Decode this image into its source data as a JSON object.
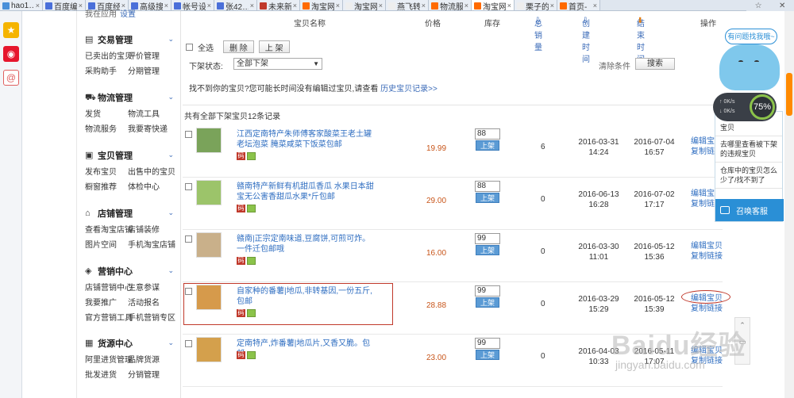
{
  "browser_tabs": [
    {
      "label": "hao1…",
      "color": "#4a90d9"
    },
    {
      "label": "百度编",
      "color": "#4a6fd9"
    },
    {
      "label": "百度经",
      "color": "#4a6fd9"
    },
    {
      "label": "高级搜",
      "color": "#4a6fd9"
    },
    {
      "label": "帐号设",
      "color": "#4a6fd9"
    },
    {
      "label": "张42…",
      "color": "#4a6fd9"
    },
    {
      "label": "未来新",
      "color": "#c0392b"
    },
    {
      "label": "淘宝网",
      "color": "#ff6a00"
    },
    {
      "label": "淘宝网",
      "color": "#eeeeee"
    },
    {
      "label": "燕飞转",
      "color": "#eeeeee"
    },
    {
      "label": "物流服",
      "color": "#ff6a00"
    },
    {
      "label": "淘宝网",
      "color": "#ff6a00"
    },
    {
      "label": "栗子的",
      "color": "#eeeeee"
    },
    {
      "label": "首页-",
      "color": "#ff6a00"
    }
  ],
  "left_nav": {
    "top_text": "我在应用",
    "top_sub": "设置",
    "groups": [
      {
        "icon": "document-icon",
        "title": "交易管理",
        "links": [
          "已卖出的宝贝",
          "评价管理",
          "采购助手",
          "分期管理"
        ]
      },
      {
        "icon": "truck-icon",
        "title": "物流管理",
        "links": [
          "发货",
          "物流工具",
          "物流服务",
          "我要寄快递"
        ]
      },
      {
        "icon": "bag-icon",
        "title": "宝贝管理",
        "links": [
          "发布宝贝",
          "出售中的宝贝",
          "橱窗推荐",
          "体检中心"
        ]
      },
      {
        "icon": "shop-icon",
        "title": "店铺管理",
        "links": [
          "查看淘宝店铺",
          "店铺装修",
          "图片空间",
          "手机淘宝店铺"
        ]
      },
      {
        "icon": "megaphone-icon",
        "title": "营销中心",
        "links": [
          "店铺营销中心",
          "生意参谋",
          "我要推广",
          "活动报名",
          "官方营销工具",
          "手机营销专区"
        ]
      },
      {
        "icon": "cube-icon",
        "title": "货源中心",
        "links": [
          "阿里进货管理",
          "品牌货源",
          "批发进货",
          "分销管理"
        ]
      }
    ]
  },
  "table_header": {
    "name": "宝贝名称",
    "price": "价格",
    "stock": "库存",
    "sales": "总销量",
    "created": "创建时间",
    "end": "结束时间",
    "ops": "操作"
  },
  "toolbar": {
    "select_all": "全选",
    "delete": "删 除",
    "list": "上 架"
  },
  "filter": {
    "label": "下架状态:",
    "value": "全部下架",
    "clear": "清除条件",
    "search": "搜索"
  },
  "hint": {
    "text": "找不到你的宝贝?您可能长时间没有编辑过宝贝,请查看",
    "link": "历史宝贝记录>>"
  },
  "count_text": "共有全部下架宝贝12条记录",
  "rows": [
    {
      "title": "江西定南特产朱师傅客家酸菜王老土罐老坛泡菜 腌菜咸菜下饭菜包邮",
      "price": "19.99",
      "stock": "88",
      "shelf": "上架",
      "sales": "6",
      "created": [
        "2016-03-31",
        "14:24"
      ],
      "end": [
        "2016-07-04",
        "16:57"
      ],
      "ops": [
        "编辑宝贝",
        "复制链接"
      ],
      "thumb_color": "#7aa35a"
    },
    {
      "title": "赣南特产新鲜有机甜瓜香瓜 水果日本甜宝无公害香甜瓜水果*斤包邮",
      "price": "29.00",
      "stock": "88",
      "shelf": "上架",
      "sales": "0",
      "created": [
        "2016-06-13",
        "16:28"
      ],
      "end": [
        "2016-07-02",
        "17:17"
      ],
      "ops": [
        "编辑宝贝",
        "复制链接"
      ],
      "thumb_color": "#9cc46a"
    },
    {
      "title": "赣南|正宗定南味道,豆腐饼,可煎可炸。一件迁包邮哦",
      "price": "16.00",
      "stock": "99",
      "shelf": "上架",
      "sales": "0",
      "created": [
        "2016-03-30",
        "11:01"
      ],
      "end": [
        "2016-05-12",
        "15:36"
      ],
      "ops": [
        "编辑宝贝",
        "复制链接"
      ],
      "thumb_color": "#c9b08a"
    },
    {
      "title": "自家种的番薯|地瓜,非转基因,一份五斤,包邮",
      "price": "28.88",
      "stock": "99",
      "shelf": "上架",
      "sales": "0",
      "created": [
        "2016-03-29",
        "15:29"
      ],
      "end": [
        "2016-05-12",
        "15:39"
      ],
      "ops": [
        "编辑宝贝",
        "复制链接"
      ],
      "thumb_color": "#d69a4b"
    },
    {
      "title": "定南特产,炸番薯|地瓜片,又香又脆。包邮",
      "price": "23.00",
      "stock": "99",
      "shelf": "上架",
      "sales": "0",
      "created": [
        "2016-04-03",
        "10:33"
      ],
      "end": [
        "2016-05-11",
        "17:07"
      ],
      "ops": [
        "编辑宝贝",
        "复制链接"
      ],
      "thumb_color": "#d4a04c"
    }
  ],
  "helper": {
    "bubble": "有问题找我哦~",
    "items": [
      "宝贝",
      "去哪里查看被下架的违规宝贝",
      "仓库中的宝贝怎么少了/找不到了"
    ],
    "call": "召唤客服",
    "speed_up": "0K/s",
    "speed_down": "0K/s",
    "speed_pct": "75%"
  },
  "watermark": {
    "line1": "Baidu经验",
    "line2": "jingyan.baidu.com"
  }
}
